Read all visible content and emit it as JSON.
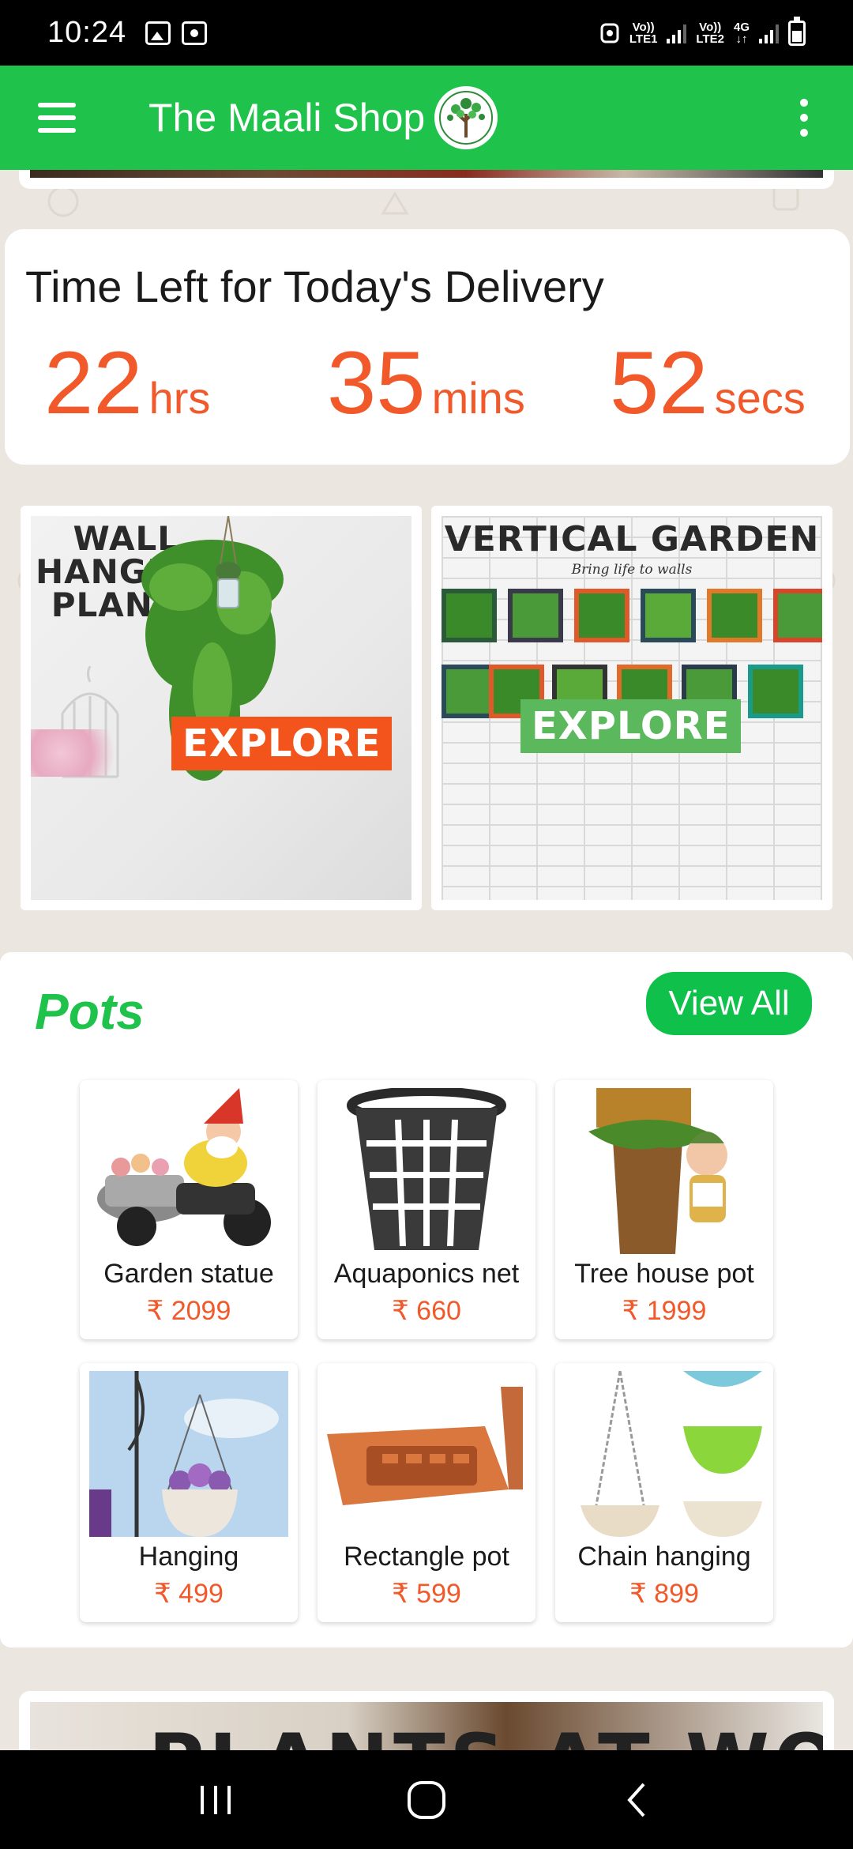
{
  "status_bar": {
    "time": "10:24",
    "sim1_label_top": "Vo))",
    "sim1_label_bottom": "LTE1",
    "sim2_label_top": "Vo))",
    "sim2_label_bottom": "LTE2",
    "network": "4G"
  },
  "app_bar": {
    "title": "The Maali Shop"
  },
  "countdown": {
    "title": "Time Left for Today's Delivery",
    "hours": "22",
    "hours_label": "hrs",
    "minutes": "35",
    "minutes_label": "mins",
    "seconds": "52",
    "seconds_label": "secs"
  },
  "banners": [
    {
      "heading_line1": "WALL",
      "heading_line2": "HANGING",
      "heading_line3": "PLANTS",
      "button": "EXPLORE"
    },
    {
      "heading": "VERTICAL GARDEN",
      "tagline": "Bring life to walls",
      "button": "EXPLORE"
    }
  ],
  "pots": {
    "title": "Pots",
    "view_all": "View All",
    "products": [
      {
        "name": "Garden statue",
        "price": "₹ 2099"
      },
      {
        "name": "Aquaponics net",
        "price": "₹ 660"
      },
      {
        "name": "Tree house pot",
        "price": "₹ 1999"
      },
      {
        "name": "Hanging",
        "price": "₹ 499"
      },
      {
        "name": "Rectangle pot",
        "price": "₹ 599"
      },
      {
        "name": "Chain hanging",
        "price": "₹ 899"
      }
    ]
  },
  "bottom_banner": {
    "text": "PLANTS AT WORK"
  },
  "colors": {
    "brand_green": "#1fc24a",
    "accent_orange": "#f1592a"
  }
}
